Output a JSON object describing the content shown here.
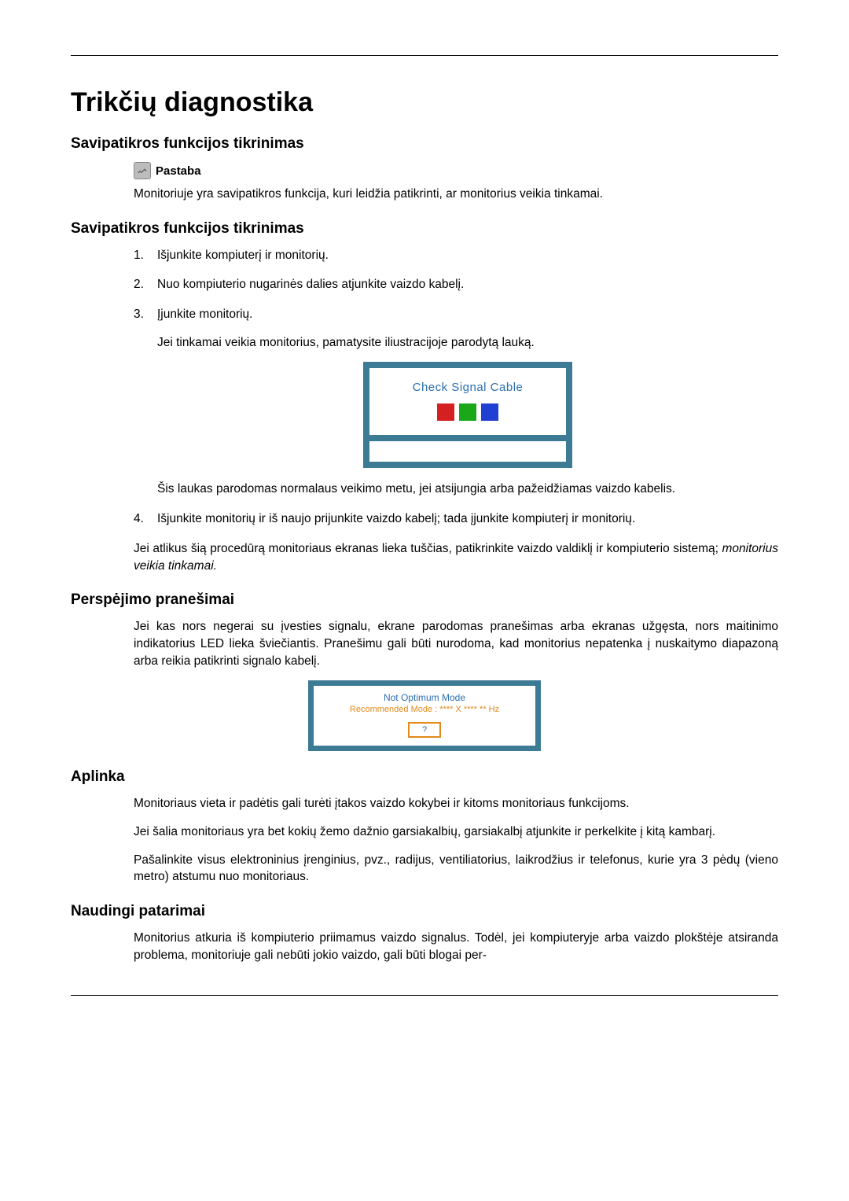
{
  "title": "Trikčių diagnostika",
  "sections": {
    "s1": {
      "heading": "Savipatikros funkcijos tikrinimas",
      "note_label": "Pastaba",
      "note_text": "Monitoriuje yra savipatikros funkcija, kuri leidžia patikrinti, ar monitorius veikia tinkamai."
    },
    "s2": {
      "heading": "Savipatikros funkcijos tikrinimas",
      "steps": {
        "i1": "Išjunkite kompiuterį ir monitorių.",
        "i2": "Nuo kompiuterio nugarinės dalies atjunkite vaizdo kabelį.",
        "i3": "Įjunkite monitorių.",
        "i3_sub": "Jei tinkamai veikia monitorius, pamatysite iliustracijoje parodytą lauką.",
        "i3_after": "Šis laukas parodomas normalaus veikimo metu, jei atsijungia arba pažeidžiamas vaizdo kabelis.",
        "i4": "Išjunkite monitorių ir iš naujo prijunkite vaizdo kabelį; tada įjunkite kompiuterį ir monitorių."
      },
      "after_text": "Jei atlikus šią procedūrą monitoriaus ekranas lieka tuščias, patikrinkite vaizdo valdiklį ir kompiuterio sistemą; ",
      "after_italic": "monitorius veikia tinkamai."
    },
    "s3": {
      "heading": "Perspėjimo pranešimai",
      "text": "Jei kas nors negerai su įvesties signalu, ekrane parodomas pranešimas arba ekranas užgęsta, nors maitinimo indikatorius LED lieka šviečiantis. Pranešimu gali būti nurodoma, kad monitorius nepatenka į nuskaitymo diapazoną arba reikia patikrinti signalo kabelį."
    },
    "s4": {
      "heading": "Aplinka",
      "p1": "Monitoriaus vieta ir padėtis gali turėti įtakos vaizdo kokybei ir kitoms monitoriaus funkcijoms.",
      "p2": "Jei šalia monitoriaus yra bet kokių žemo dažnio garsiakalbių, garsiakalbį atjunkite ir perkelkite į kitą kambarį.",
      "p3": "Pašalinkite visus elektroninius įrenginius, pvz., radijus, ventiliatorius, laikrodžius ir telefonus, kurie yra 3 pėdų (vieno metro) atstumu nuo monitoriaus."
    },
    "s5": {
      "heading": "Naudingi patarimai",
      "p1": "Monitorius atkuria iš kompiuterio priimamus vaizdo signalus. Todėl, jei kompiuteryje arba vaizdo plokštėje atsiranda problema, monitoriuje gali nebūti jokio vaizdo, gali būti blogai per-"
    }
  },
  "figures": {
    "csc": {
      "title": "Check Signal Cable"
    },
    "nom": {
      "line1": "Not Optimum Mode",
      "line2": "Recommended Mode : **** X **** ** Hz",
      "button": "?"
    }
  }
}
